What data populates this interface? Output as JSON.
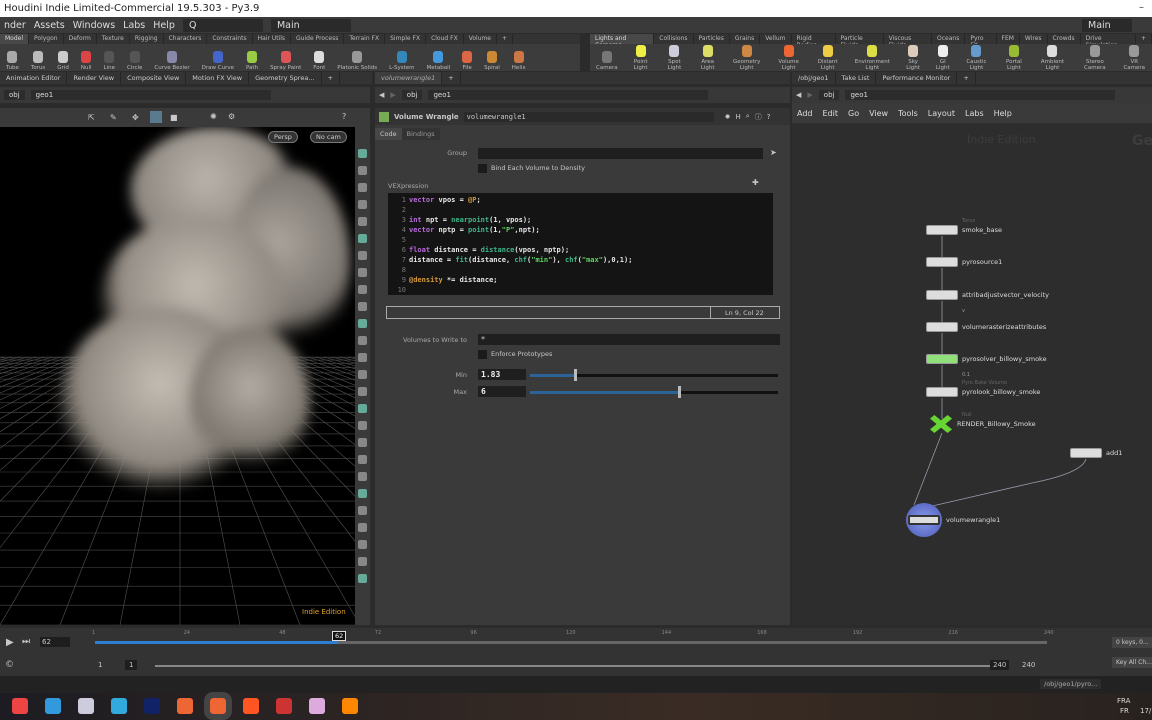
{
  "window": {
    "title": "Houdini Indie Limited-Commercial 19.5.303 - Py3.9"
  },
  "menubar": {
    "items": [
      "nder",
      "Assets",
      "Windows",
      "Labs",
      "Help"
    ],
    "search": "Q",
    "desktop": "Main",
    "desktop_right": "Main"
  },
  "shelf_left": {
    "tabs": [
      "Model",
      "Polygon",
      "Deform",
      "Texture",
      "Rigging",
      "Characters",
      "Constraints",
      "Hair Utils",
      "Guide Process",
      "Terrain FX",
      "Simple FX",
      "Cloud FX",
      "Volume"
    ],
    "active": "Model",
    "tools": [
      {
        "label": "Tube",
        "color": "#aaa"
      },
      {
        "label": "Torus",
        "color": "#bbb"
      },
      {
        "label": "Grid",
        "color": "#ccc"
      },
      {
        "label": "Null",
        "color": "#d44"
      },
      {
        "label": "Line",
        "color": "#555"
      },
      {
        "label": "Circle",
        "color": "#555"
      },
      {
        "label": "Curve Bezier",
        "color": "#88a"
      },
      {
        "label": "Draw Curve",
        "color": "#46c"
      },
      {
        "label": "Path",
        "color": "#9c4"
      },
      {
        "label": "Spray Paint",
        "color": "#d55"
      },
      {
        "label": "Font",
        "color": "#ddd"
      },
      {
        "label": "Platonic Solids",
        "color": "#999"
      },
      {
        "label": "L-System",
        "color": "#38b"
      },
      {
        "label": "Metaball",
        "color": "#49d"
      },
      {
        "label": "File",
        "color": "#d64"
      },
      {
        "label": "Spiral",
        "color": "#c83"
      },
      {
        "label": "Helix",
        "color": "#c74"
      }
    ]
  },
  "shelf_right": {
    "tabs": [
      "Lights and Cameras",
      "Collisions",
      "Particles",
      "Grains",
      "Vellum",
      "Rigid Bodies",
      "Particle Fluids",
      "Viscous Fluids",
      "Oceans",
      "Pyro FX",
      "FEM",
      "Wires",
      "Crowds",
      "Drive Simulation"
    ],
    "active": "Lights and Cameras",
    "tools": [
      {
        "label": "Camera",
        "color": "#777"
      },
      {
        "label": "Point Light",
        "color": "#ee4"
      },
      {
        "label": "Spot Light",
        "color": "#ccd"
      },
      {
        "label": "Area Light",
        "color": "#dd6"
      },
      {
        "label": "Geometry Light",
        "color": "#c84"
      },
      {
        "label": "Volume Light",
        "color": "#e63"
      },
      {
        "label": "Distant Light",
        "color": "#ec4"
      },
      {
        "label": "Environment Light",
        "color": "#dd4"
      },
      {
        "label": "Sky Light",
        "color": "#dcb"
      },
      {
        "label": "GI Light",
        "color": "#eee"
      },
      {
        "label": "Caustic Light",
        "color": "#69c"
      },
      {
        "label": "Portal Light",
        "color": "#9b3"
      },
      {
        "label": "Ambient Light",
        "color": "#ddd"
      },
      {
        "label": "Stereo Camera",
        "color": "#999"
      },
      {
        "label": "VR Camera",
        "color": "#999"
      }
    ]
  },
  "left_pane": {
    "tabs": [
      "Animation Editor",
      "Render View",
      "Composite View",
      "Motion FX View",
      "Geometry Sprea..."
    ],
    "path": [
      "obj",
      "geo1"
    ],
    "view_label": "Persp",
    "camera_label": "No cam",
    "watermark": "Indie Edition"
  },
  "params_pane": {
    "tab": "volumewrangle1",
    "path": [
      "obj",
      "geo1"
    ],
    "node_type": "Volume Wrangle",
    "node_name": "volumewrangle1",
    "subtabs": [
      "Code",
      "Bindings"
    ],
    "group_label": "Group",
    "group_value": "",
    "bind_each_label": "Bind Each Volume to Density",
    "vex_label": "VEXpression",
    "code": [
      [
        [
          "vector",
          "kw"
        ],
        [
          " vpos = ",
          "tx"
        ],
        [
          "@P",
          "at"
        ],
        [
          ";",
          "tx"
        ]
      ],
      [],
      [
        [
          "int",
          "kw"
        ],
        [
          " npt = ",
          "tx"
        ],
        [
          "nearpoint",
          "fn"
        ],
        [
          "(1, vpos);",
          "tx"
        ]
      ],
      [
        [
          "vector",
          "kw"
        ],
        [
          " nptp = ",
          "tx"
        ],
        [
          "point",
          "fn"
        ],
        [
          "(1,",
          "tx"
        ],
        [
          "\"P\"",
          "st"
        ],
        [
          ",npt);",
          "tx"
        ]
      ],
      [],
      [
        [
          "float",
          "kw"
        ],
        [
          " distance = ",
          "tx"
        ],
        [
          "distance",
          "fn"
        ],
        [
          "(vpos, nptp);",
          "tx"
        ]
      ],
      [
        [
          "distance = ",
          "tx"
        ],
        [
          "fit",
          "fn"
        ],
        [
          "(distance, ",
          "tx"
        ],
        [
          "chf",
          "fn"
        ],
        [
          "(",
          "tx"
        ],
        [
          "\"min\"",
          "st"
        ],
        [
          "), ",
          "tx"
        ],
        [
          "chf",
          "fn"
        ],
        [
          "(",
          "tx"
        ],
        [
          "\"max\"",
          "st"
        ],
        [
          "),0,1);",
          "tx"
        ]
      ],
      [],
      [
        [
          "@density",
          "at"
        ],
        [
          " *= distance;",
          "tx"
        ]
      ],
      []
    ],
    "cursor_pos": "Ln 9, Col 22",
    "volumes_label": "Volumes to Write to",
    "volumes_value": "*",
    "enforce_label": "Enforce Prototypes",
    "min_label": "Min",
    "min_value": "1.83",
    "min_slider_fraction": 0.18,
    "max_label": "Max",
    "max_value": "6",
    "max_slider_fraction": 0.6
  },
  "network_pane": {
    "tabs": [
      "/obj/geo1",
      "Take List",
      "Performance Monitor"
    ],
    "path": [
      "obj",
      "geo1"
    ],
    "menu": [
      "Add",
      "Edit",
      "Go",
      "View",
      "Tools",
      "Layout",
      "Labs",
      "Help"
    ],
    "watermark": "Indie Edition",
    "context_label": "Ge",
    "nodes": [
      {
        "name": "smoke_base",
        "comment": "Torus"
      },
      {
        "name": "pyrosource1"
      },
      {
        "name": "attribadjustvector_velocity",
        "sub": "v"
      },
      {
        "name": "volumerasterizeattributes"
      },
      {
        "name": "pyrosolver_billowy_smoke",
        "sub": "0.1"
      },
      {
        "name": "pyrolook_billowy_smoke",
        "comment": "Pyro Bake Volume"
      },
      {
        "name": "RENDER_Billowy_Smoke",
        "comment": "Null"
      },
      {
        "name": "add1"
      },
      {
        "name": "volumewrangle1"
      }
    ]
  },
  "timeline": {
    "current_frame": "62",
    "ticks": [
      "1",
      "24",
      "48",
      "72",
      "96",
      "120",
      "144",
      "168",
      "192",
      "216",
      "240"
    ],
    "range_start": "1",
    "range_start2": "1",
    "range_end": "240",
    "range_end2": "240",
    "keys_label": "0 keys, 0...",
    "key_all_label": "Key All Ch...",
    "status_path": "/obj/geo1/pyro..."
  },
  "taskbar": {
    "lang": "FRA",
    "lang2": "FR",
    "date": "17/"
  }
}
